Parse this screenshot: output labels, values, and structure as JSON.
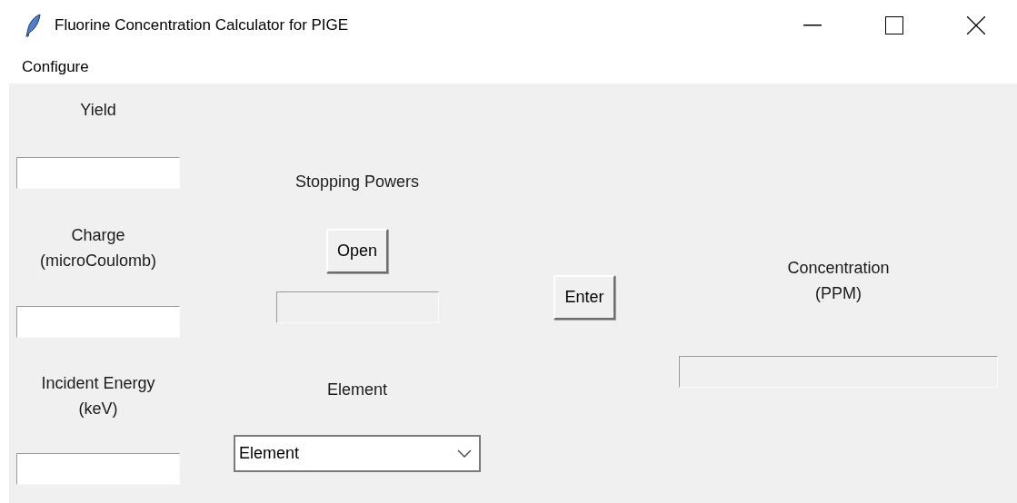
{
  "window": {
    "title": "Fluorine Concentration Calculator for PIGE"
  },
  "menu_bar": [
    {
      "label": "Configure"
    }
  ],
  "inputs": [
    {
      "label": "Yield"
    },
    {
      "label": "Charge\n(microCoulomb)"
    },
    {
      "label": "Incident Energy\n(keV)"
    }
  ],
  "stopping_powers": {
    "label": "Stopping Powers",
    "button": "Open",
    "file_field": {
      "disabled": true
    }
  },
  "element": {
    "label": "Element",
    "combobox": {
      "value": "Element"
    }
  },
  "enter_button": "Enter",
  "concentration": {
    "label": "Concentration\n(PPM)",
    "field": {
      "disabled": true
    }
  }
}
